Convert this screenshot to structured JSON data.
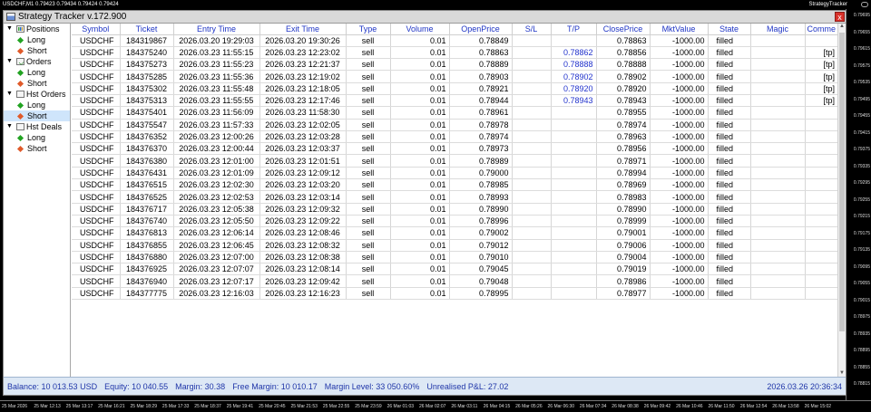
{
  "chart": {
    "header_left": "USDCHF,M1  0.79423 0.79434 0.79424 0.79424",
    "header_right": "StrategyTracker",
    "price_ticks": [
      "0.79695",
      "0.79655",
      "0.79615",
      "0.79575",
      "0.79535",
      "0.79495",
      "0.79455",
      "0.79415",
      "0.79375",
      "0.79335",
      "0.79295",
      "0.79255",
      "0.79215",
      "0.79175",
      "0.79135",
      "0.79095",
      "0.79055",
      "0.79015",
      "0.78975",
      "0.78935",
      "0.78895",
      "0.78855",
      "0.78815"
    ],
    "time_ticks": [
      "25 Mar 2026",
      "25 Mar 12:13",
      "25 Mar 13:17",
      "25 Mar 16:21",
      "25 Mar 18:29",
      "25 Mar 17:33",
      "25 Mar 18:37",
      "25 Mar 19:41",
      "25 Mar 20:45",
      "25 Mar 21:53",
      "25 Mar 22:55",
      "25 Mar 23:59",
      "26 Mar 01:03",
      "26 Mar 02:07",
      "26 Mar 03:11",
      "26 Mar 04:15",
      "26 Mar 05:26",
      "26 Mar 06:30",
      "26 Mar 07:34",
      "26 Mar 08:38",
      "26 Mar 09:42",
      "26 Mar 10:46",
      "26 Mar 11:50",
      "26 Mar 12:54",
      "26 Mar 13:58",
      "26 Mar 15:02"
    ]
  },
  "window": {
    "title": "Strategy Tracker v.172.900",
    "close": "x"
  },
  "tree": [
    {
      "label": "Positions",
      "icon": "positions-icon"
    },
    {
      "label": "Long",
      "type": "long"
    },
    {
      "label": "Short",
      "type": "short"
    },
    {
      "label": "Orders",
      "icon": "orders-icon"
    },
    {
      "label": "Long",
      "type": "long"
    },
    {
      "label": "Short",
      "type": "short"
    },
    {
      "label": "Hst Orders",
      "icon": "document-icon"
    },
    {
      "label": "Long",
      "type": "long"
    },
    {
      "label": "Short",
      "type": "short",
      "selected": true
    },
    {
      "label": "Hst Deals",
      "icon": "deals-icon"
    },
    {
      "label": "Long",
      "type": "long"
    },
    {
      "label": "Short",
      "type": "short"
    }
  ],
  "columns": [
    "Symbol",
    "Ticket",
    "Entry Time",
    "Exit Time",
    "Type",
    "Volume",
    "OpenPrice",
    "S/L",
    "T/P",
    "ClosePrice",
    "MktValue",
    "State",
    "Magic",
    "Comme"
  ],
  "rows": [
    [
      "USDCHF",
      "184319867",
      "2026.03.20 19:29:03",
      "2026.03.20 19:30:26",
      "sell",
      "0.01",
      "0.78849",
      "",
      "",
      "0.78863",
      "-1000.00",
      "filled",
      "",
      ""
    ],
    [
      "USDCHF",
      "184375240",
      "2026.03.23 11:55:15",
      "2026.03.23 12:23:02",
      "sell",
      "0.01",
      "0.78863",
      "",
      "0.78862",
      "0.78856",
      "-1000.00",
      "filled",
      "",
      "[tp]"
    ],
    [
      "USDCHF",
      "184375273",
      "2026.03.23 11:55:23",
      "2026.03.23 12:21:37",
      "sell",
      "0.01",
      "0.78889",
      "",
      "0.78888",
      "0.78888",
      "-1000.00",
      "filled",
      "",
      "[tp]"
    ],
    [
      "USDCHF",
      "184375285",
      "2026.03.23 11:55:36",
      "2026.03.23 12:19:02",
      "sell",
      "0.01",
      "0.78903",
      "",
      "0.78902",
      "0.78902",
      "-1000.00",
      "filled",
      "",
      "[tp]"
    ],
    [
      "USDCHF",
      "184375302",
      "2026.03.23 11:55:48",
      "2026.03.23 12:18:05",
      "sell",
      "0.01",
      "0.78921",
      "",
      "0.78920",
      "0.78920",
      "-1000.00",
      "filled",
      "",
      "[tp]"
    ],
    [
      "USDCHF",
      "184375313",
      "2026.03.23 11:55:55",
      "2026.03.23 12:17:46",
      "sell",
      "0.01",
      "0.78944",
      "",
      "0.78943",
      "0.78943",
      "-1000.00",
      "filled",
      "",
      "[tp]"
    ],
    [
      "USDCHF",
      "184375401",
      "2026.03.23 11:56:09",
      "2026.03.23 11:58:30",
      "sell",
      "0.01",
      "0.78961",
      "",
      "",
      "0.78955",
      "-1000.00",
      "filled",
      "",
      ""
    ],
    [
      "USDCHF",
      "184375547",
      "2026.03.23 11:57:33",
      "2026.03.23 12:02:05",
      "sell",
      "0.01",
      "0.78978",
      "",
      "",
      "0.78974",
      "-1000.00",
      "filled",
      "",
      ""
    ],
    [
      "USDCHF",
      "184376352",
      "2026.03.23 12:00:26",
      "2026.03.23 12:03:28",
      "sell",
      "0.01",
      "0.78974",
      "",
      "",
      "0.78963",
      "-1000.00",
      "filled",
      "",
      ""
    ],
    [
      "USDCHF",
      "184376370",
      "2026.03.23 12:00:44",
      "2026.03.23 12:03:37",
      "sell",
      "0.01",
      "0.78973",
      "",
      "",
      "0.78956",
      "-1000.00",
      "filled",
      "",
      ""
    ],
    [
      "USDCHF",
      "184376380",
      "2026.03.23 12:01:00",
      "2026.03.23 12:01:51",
      "sell",
      "0.01",
      "0.78989",
      "",
      "",
      "0.78971",
      "-1000.00",
      "filled",
      "",
      ""
    ],
    [
      "USDCHF",
      "184376431",
      "2026.03.23 12:01:09",
      "2026.03.23 12:09:12",
      "sell",
      "0.01",
      "0.79000",
      "",
      "",
      "0.78994",
      "-1000.00",
      "filled",
      "",
      ""
    ],
    [
      "USDCHF",
      "184376515",
      "2026.03.23 12:02:30",
      "2026.03.23 12:03:20",
      "sell",
      "0.01",
      "0.78985",
      "",
      "",
      "0.78969",
      "-1000.00",
      "filled",
      "",
      ""
    ],
    [
      "USDCHF",
      "184376525",
      "2026.03.23 12:02:53",
      "2026.03.23 12:03:14",
      "sell",
      "0.01",
      "0.78993",
      "",
      "",
      "0.78983",
      "-1000.00",
      "filled",
      "",
      ""
    ],
    [
      "USDCHF",
      "184376717",
      "2026.03.23 12:05:38",
      "2026.03.23 12:09:32",
      "sell",
      "0.01",
      "0.78990",
      "",
      "",
      "0.78990",
      "-1000.00",
      "filled",
      "",
      ""
    ],
    [
      "USDCHF",
      "184376740",
      "2026.03.23 12:05:50",
      "2026.03.23 12:09:22",
      "sell",
      "0.01",
      "0.78996",
      "",
      "",
      "0.78999",
      "-1000.00",
      "filled",
      "",
      ""
    ],
    [
      "USDCHF",
      "184376813",
      "2026.03.23 12:06:14",
      "2026.03.23 12:08:46",
      "sell",
      "0.01",
      "0.79002",
      "",
      "",
      "0.79001",
      "-1000.00",
      "filled",
      "",
      ""
    ],
    [
      "USDCHF",
      "184376855",
      "2026.03.23 12:06:45",
      "2026.03.23 12:08:32",
      "sell",
      "0.01",
      "0.79012",
      "",
      "",
      "0.79006",
      "-1000.00",
      "filled",
      "",
      ""
    ],
    [
      "USDCHF",
      "184376880",
      "2026.03.23 12:07:00",
      "2026.03.23 12:08:38",
      "sell",
      "0.01",
      "0.79010",
      "",
      "",
      "0.79004",
      "-1000.00",
      "filled",
      "",
      ""
    ],
    [
      "USDCHF",
      "184376925",
      "2026.03.23 12:07:07",
      "2026.03.23 12:08:14",
      "sell",
      "0.01",
      "0.79045",
      "",
      "",
      "0.79019",
      "-1000.00",
      "filled",
      "",
      ""
    ],
    [
      "USDCHF",
      "184376940",
      "2026.03.23 12:07:17",
      "2026.03.23 12:09:42",
      "sell",
      "0.01",
      "0.79048",
      "",
      "",
      "0.78986",
      "-1000.00",
      "filled",
      "",
      ""
    ],
    [
      "USDCHF",
      "184377775",
      "2026.03.23 12:16:03",
      "2026.03.23 12:16:23",
      "sell",
      "0.01",
      "0.78995",
      "",
      "",
      "0.78977",
      "-1000.00",
      "filled",
      "",
      ""
    ]
  ],
  "status": {
    "balance": "Balance: 10 013.53 USD",
    "equity": "Equity: 10 040.55",
    "margin": "Margin: 30.38",
    "free_margin": "Free Margin: 10 010.17",
    "margin_level": "Margin Level: 33 050.60%",
    "unrealised": "Unrealised P&L: 27.02",
    "datetime": "2026.03.26 20:36:34"
  }
}
